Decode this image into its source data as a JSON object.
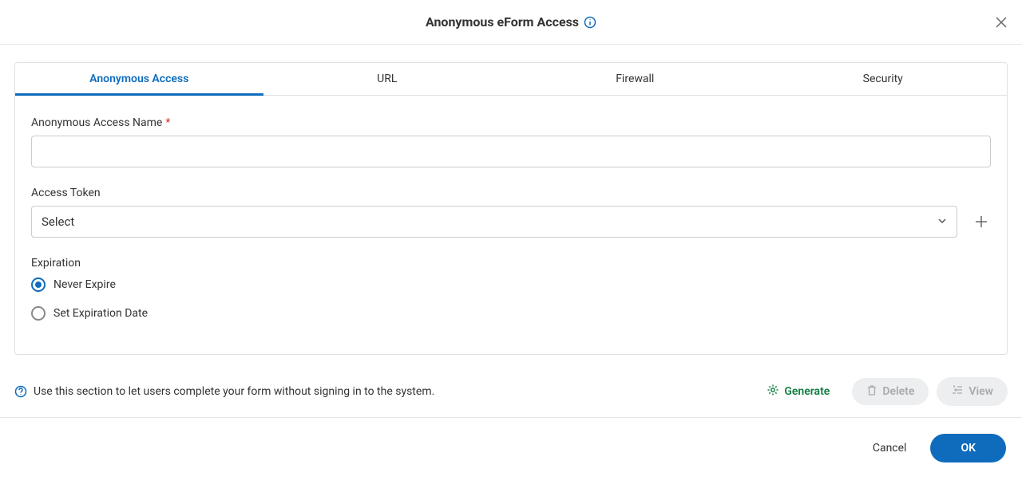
{
  "header": {
    "title": "Anonymous eForm Access"
  },
  "tabs": [
    {
      "label": "Anonymous Access",
      "active": true
    },
    {
      "label": "URL",
      "active": false
    },
    {
      "label": "Firewall",
      "active": false
    },
    {
      "label": "Security",
      "active": false
    }
  ],
  "form": {
    "name_label": "Anonymous Access Name",
    "name_value": "",
    "token_label": "Access Token",
    "token_placeholder": "Select",
    "expiration_label": "Expiration",
    "radio_never": "Never Expire",
    "radio_setdate": "Set Expiration Date",
    "selected_radio": "never"
  },
  "info_text": "Use this section to let users complete your form without signing in to the system.",
  "buttons": {
    "generate": "Generate",
    "delete": "Delete",
    "view": "View",
    "cancel": "Cancel",
    "ok": "OK"
  }
}
